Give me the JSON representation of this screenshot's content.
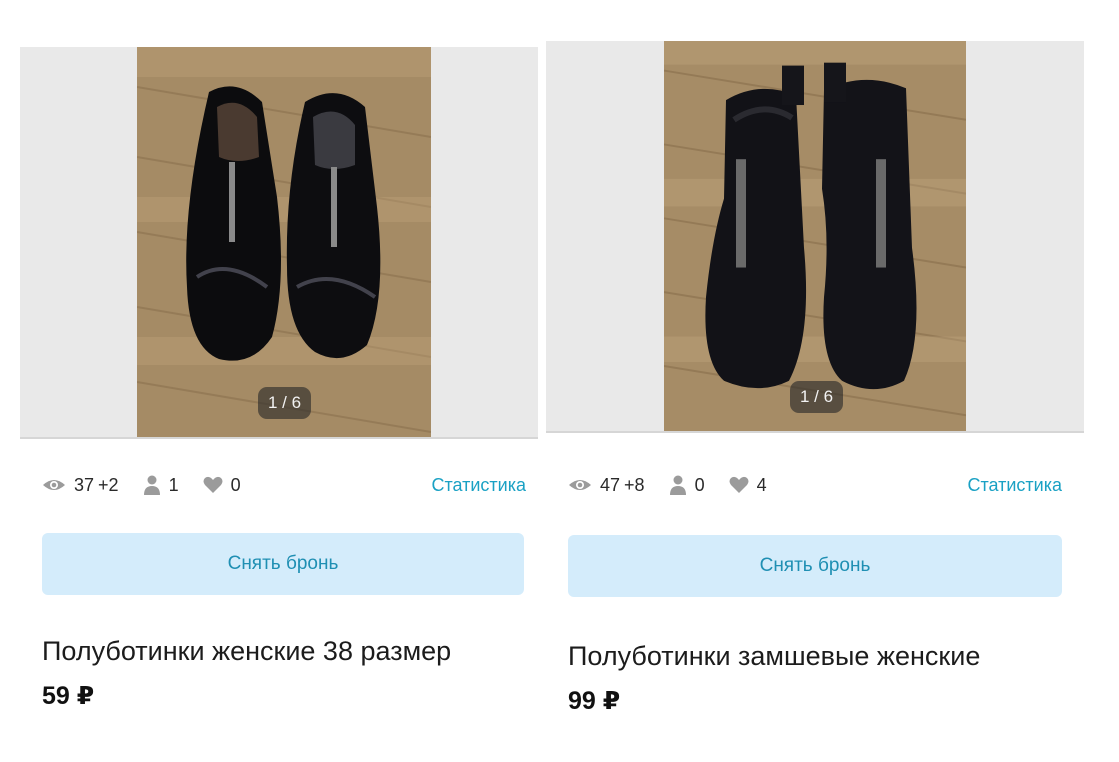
{
  "listings": [
    {
      "photo_counter": "1 / 6",
      "views": "37",
      "views_new": "+2",
      "contacts": "1",
      "favorites": "0",
      "stats_link": "Статистика",
      "action_label": "Снять бронь",
      "title": "Полуботинки женские 38 размер",
      "price": "59 ₽"
    },
    {
      "photo_counter": "1 / 6",
      "views": "47",
      "views_new": "+8",
      "contacts": "0",
      "favorites": "4",
      "stats_link": "Статистика",
      "action_label": "Снять бронь",
      "title": "Полуботинки замшевые женские",
      "price": "99 ₽"
    }
  ],
  "icons": {
    "views": "eye-icon",
    "contacts": "person-icon",
    "favorites": "heart-icon"
  },
  "colors": {
    "accent": "#1aa1c4",
    "button_bg": "#d4ecfb",
    "button_text": "#1f8fb3",
    "icon_gray": "#9b9b9b"
  }
}
